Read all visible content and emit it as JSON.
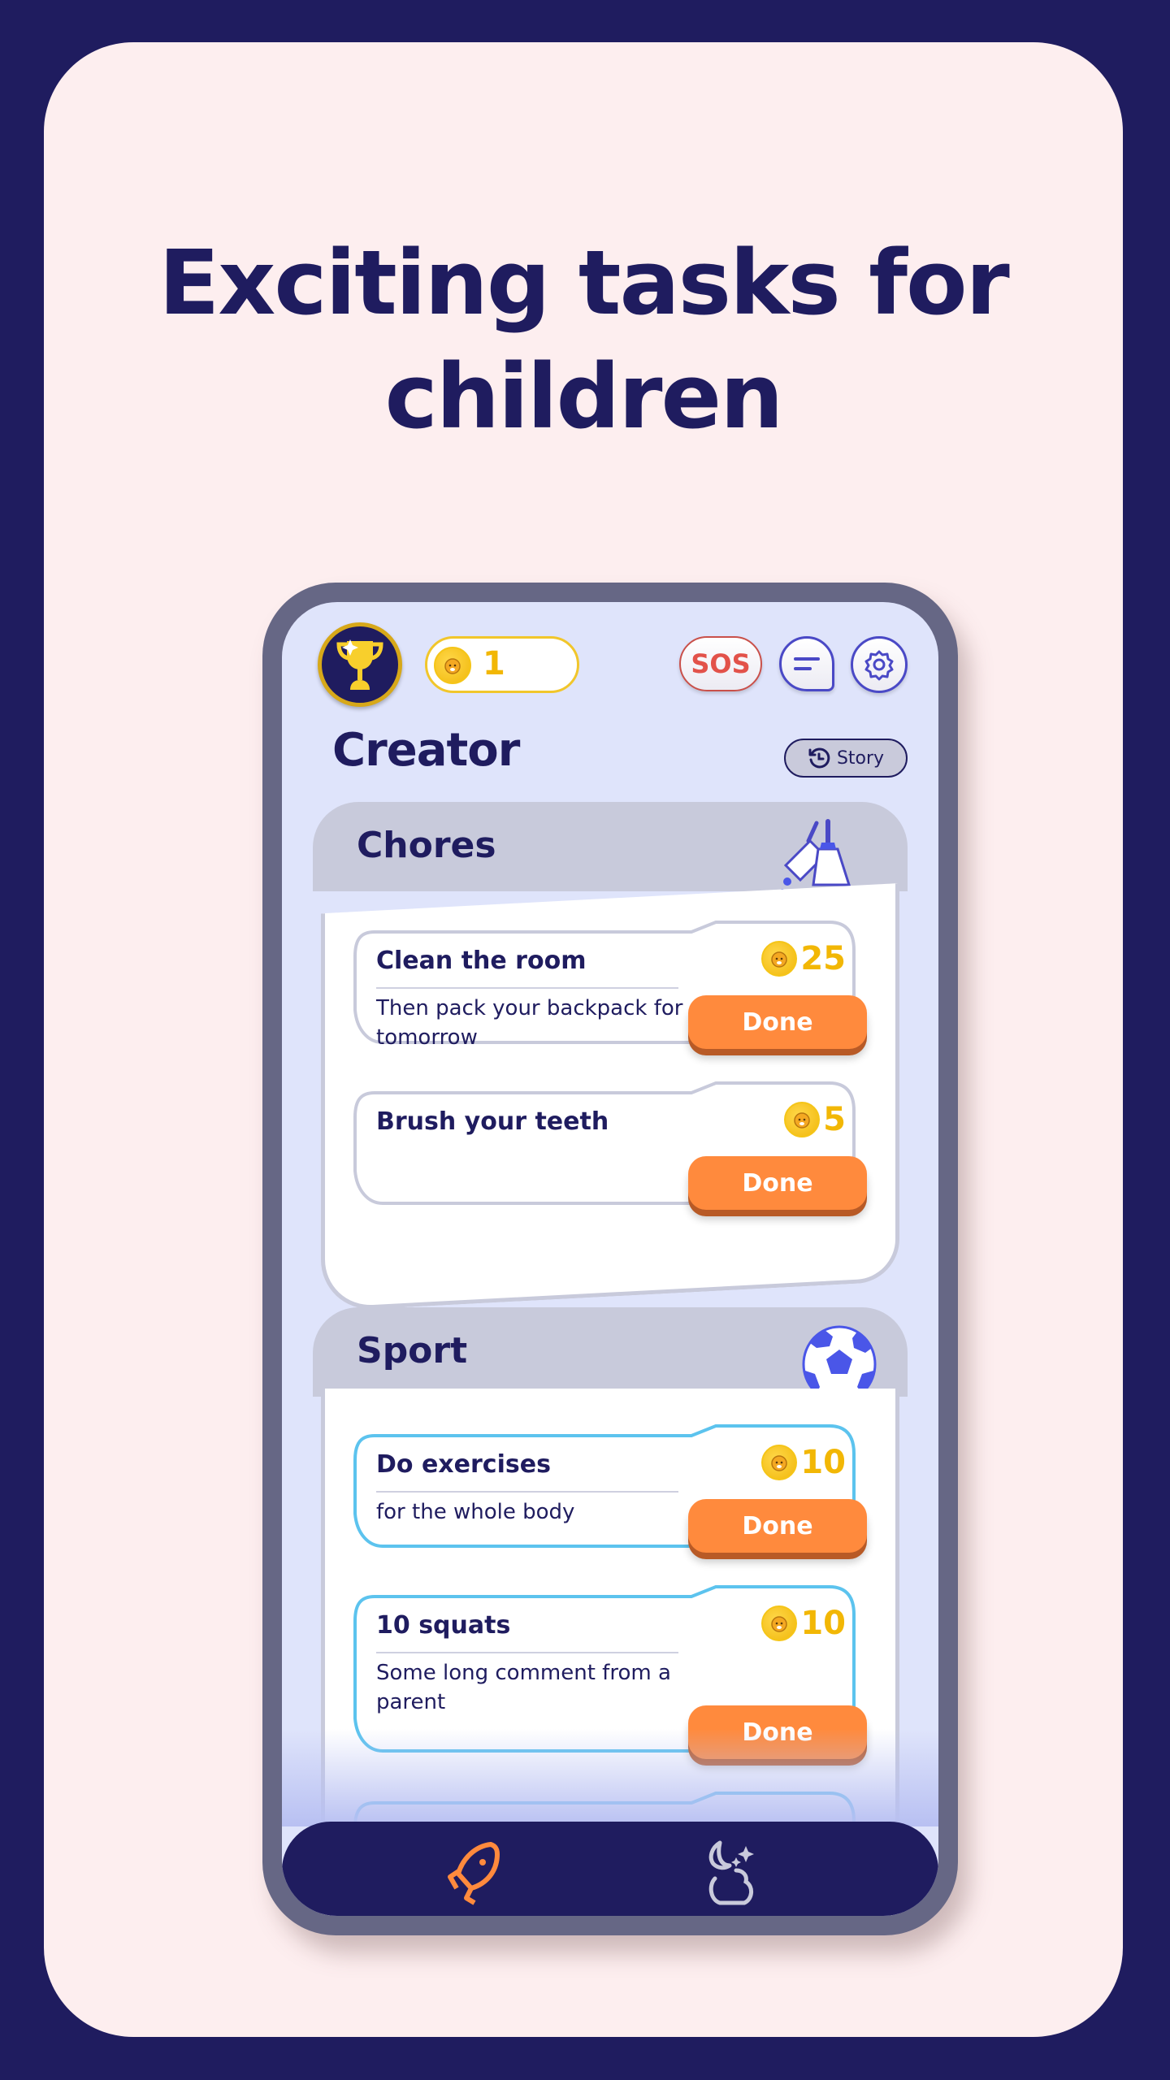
{
  "headline": {
    "line1": "Exciting tasks for",
    "line2": "children"
  },
  "topbar": {
    "trophy_icon": "trophy-icon",
    "coin_balance": "1",
    "sos_label": "SOS",
    "chat_icon": "chat-icon",
    "settings_icon": "gear-icon"
  },
  "page": {
    "title": "Creator",
    "story_label": "Story"
  },
  "categories": [
    {
      "title": "Chores",
      "icon": "broom-icon",
      "tasks": [
        {
          "name": "Clean the room",
          "comment": "Then pack your backpack for tomorrow",
          "reward": "25",
          "button": "Done"
        },
        {
          "name": "Brush your teeth",
          "comment": "",
          "reward": "5",
          "button": "Done"
        }
      ]
    },
    {
      "title": "Sport",
      "icon": "soccer-ball-icon",
      "tasks": [
        {
          "name": "Do exercises",
          "comment": "for the whole body",
          "reward": "10",
          "button": "Done"
        },
        {
          "name": "10 squats",
          "comment": "Some long comment from a parent",
          "reward": "10",
          "button": "Done"
        }
      ]
    }
  ],
  "nav": [
    {
      "icon": "rocket-icon",
      "active": true
    },
    {
      "icon": "moon-cloud-icon",
      "active": false
    }
  ],
  "colors": {
    "brand_navy": "#1f1c5f",
    "accent_orange": "#ff8a3d",
    "coin_gold": "#f2b705",
    "sport_outline": "#5cc3ee",
    "chores_outline": "#c8cadb",
    "sos_red": "#e2524a"
  }
}
